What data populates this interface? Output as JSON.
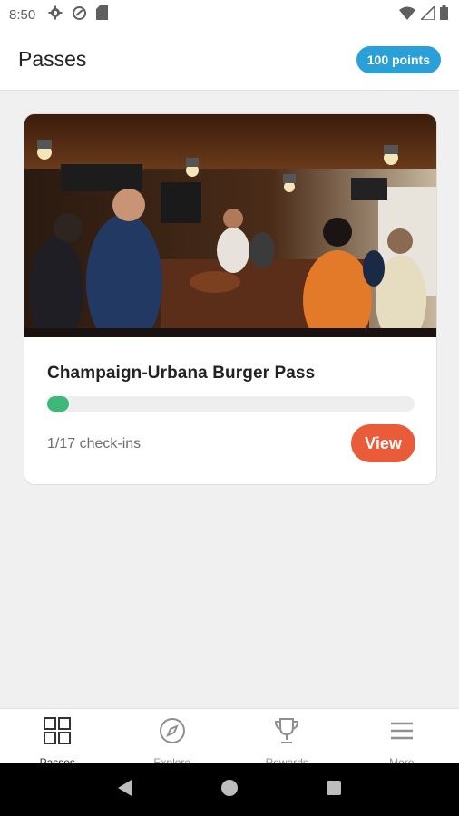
{
  "status_bar": {
    "time": "8:50",
    "left_icons": [
      "gear-icon",
      "data-saver-icon",
      "sd-card-icon"
    ],
    "right_icons": [
      "wifi-icon",
      "cell-signal-icon",
      "battery-icon"
    ]
  },
  "header": {
    "title": "Passes",
    "points_badge": "100 points",
    "accent_color": "#2aa0d8"
  },
  "pass_card": {
    "title": "Champaign-Urbana Burger Pass",
    "image": "busy-burger-bar-interior-photo",
    "progress": {
      "completed": 1,
      "total": 17,
      "fraction": 0.0588,
      "color": "#3cb878"
    },
    "checkins_text": "1/17 check-ins",
    "view_label": "View",
    "view_color": "#ea5b3a"
  },
  "bottom_nav": {
    "items": [
      {
        "label": "Passes",
        "icon": "grid-icon",
        "active": true
      },
      {
        "label": "Explore",
        "icon": "compass-icon",
        "active": false
      },
      {
        "label": "Rewards",
        "icon": "trophy-icon",
        "active": false
      },
      {
        "label": "More",
        "icon": "menu-icon",
        "active": false
      }
    ]
  },
  "system_nav": {
    "buttons": [
      "back-icon",
      "home-icon",
      "recents-icon"
    ]
  }
}
